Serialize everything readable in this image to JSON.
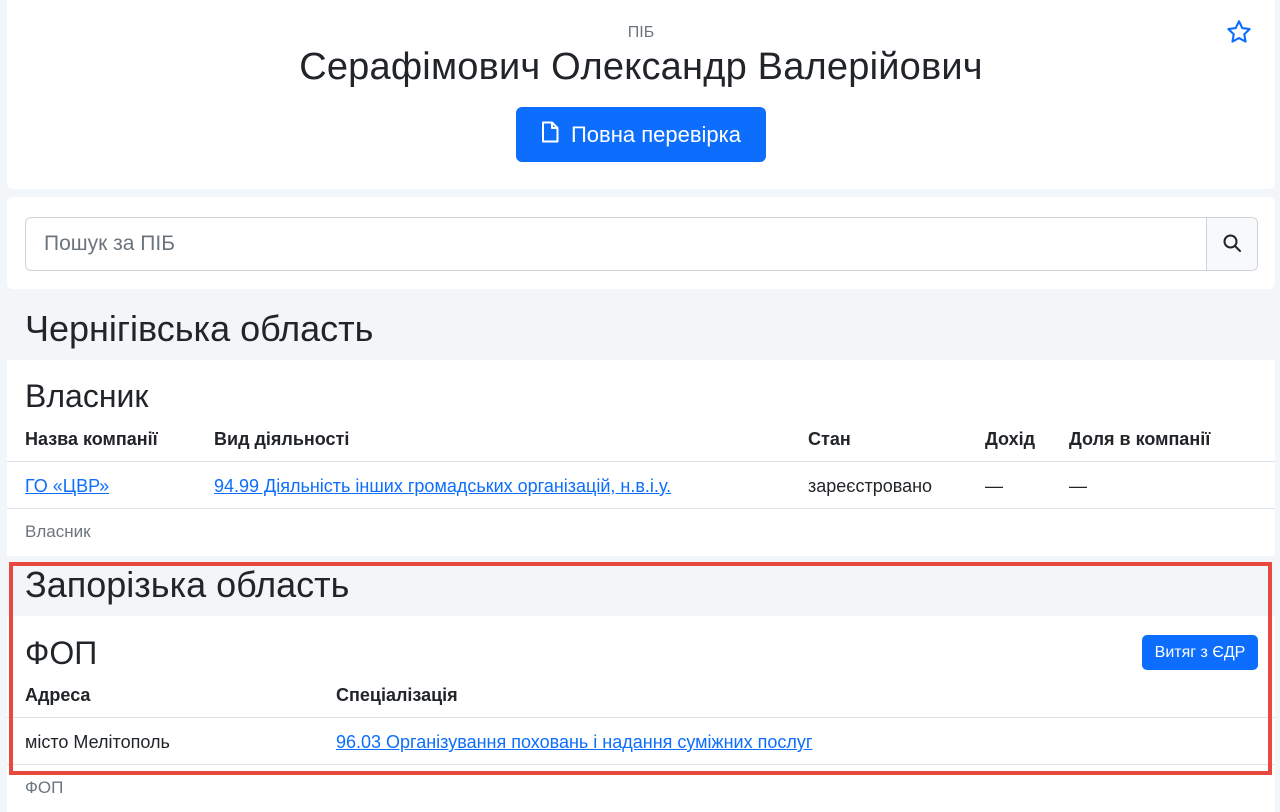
{
  "header": {
    "pib_label": "ПІБ",
    "person_name": "Серафімович Олександр Валерійович",
    "full_check_label": "Повна перевірка",
    "star_icon": "star-outline-icon",
    "document_icon": "document-icon"
  },
  "search": {
    "placeholder": "Пошук за ПІБ",
    "value": "",
    "icon": "search-icon"
  },
  "regions": [
    {
      "title": "Чернігівська область",
      "section": {
        "title": "Власник",
        "columns": [
          "Назва компанії",
          "Вид діяльності",
          "Стан",
          "Дохід",
          "Доля в компанії"
        ],
        "rows": [
          {
            "company": "ГО «ЦВР»",
            "activity": "94.99 Діяльність інших громадських організацій, н.в.і.у.",
            "status": "зареєстровано",
            "income": "—",
            "share": "—"
          }
        ],
        "footer": "Власник"
      }
    },
    {
      "title": "Запорізька область",
      "section": {
        "title": "ФОП",
        "action_label": "Витяг з ЄДР",
        "columns": [
          "Адреса",
          "Спеціалізація"
        ],
        "rows": [
          {
            "address": "місто Мелітополь",
            "specialization": "96.03 Організування поховань і надання суміжних послуг"
          }
        ],
        "footer": "ФОП"
      }
    }
  ],
  "colors": {
    "primary": "#0d6efd",
    "highlight_border": "#e8483e",
    "page_bg": "#f3f6f8"
  }
}
